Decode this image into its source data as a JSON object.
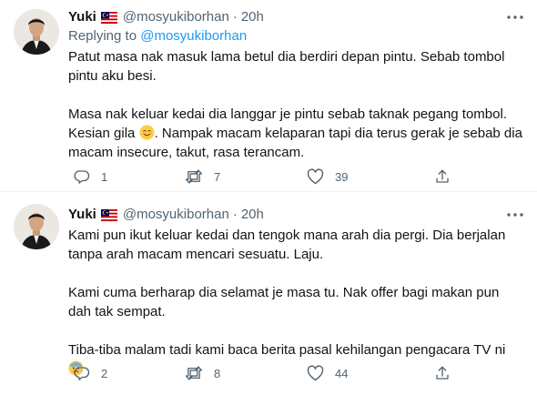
{
  "tweets": [
    {
      "author": {
        "name": "Yuki",
        "flag": "malaysia-flag",
        "handle": "@mosyukiborhan",
        "separator": "·",
        "time": "20h"
      },
      "reply_to": {
        "prefix": "Replying to",
        "mention": "@mosyukiborhan"
      },
      "paragraphs": [
        {
          "text": "Patut masa nak masuk lama betul dia berdiri depan pintu. Sebab tombol pintu aku besi."
        },
        {
          "text_before_emoji": "Masa nak keluar kedai dia langgar je pintu sebab taknak pegang tombol. Kesian gila ",
          "emoji": "smiling-face-icon",
          "text_after_emoji": ". Nampak macam kelaparan tapi dia terus gerak je sebab dia macam insecure, takut, rasa terancam."
        }
      ],
      "stats": {
        "replies": "1",
        "retweets": "7",
        "likes": "39"
      }
    },
    {
      "author": {
        "name": "Yuki",
        "flag": "malaysia-flag",
        "handle": "@mosyukiborhan",
        "separator": "·",
        "time": "20h"
      },
      "paragraphs": [
        {
          "text": "Kami pun ikut keluar kedai dan tengok mana arah dia pergi. Dia berjalan tanpa arah macam mencari sesuatu. Laju."
        },
        {
          "text": "Kami cuma berharap dia selamat je masa tu. Nak offer bagi makan pun dah tak sempat."
        },
        {
          "text_before_emoji": "Tiba-tiba malam tadi kami baca berita pasal kehilangan pengacara TV ni ",
          "emoji": "anxious-face-icon",
          "text_after_emoji": ""
        }
      ],
      "stats": {
        "replies": "2",
        "retweets": "8",
        "likes": "44"
      }
    }
  ],
  "icons": {
    "more": "more-horizontal-icon",
    "reply": "reply-icon",
    "retweet": "retweet-icon",
    "like": "heart-icon",
    "share": "share-icon"
  },
  "colors": {
    "text": "#0f1419",
    "secondary": "#536471",
    "link": "#1d9bf0",
    "divider": "#eff3f4"
  }
}
